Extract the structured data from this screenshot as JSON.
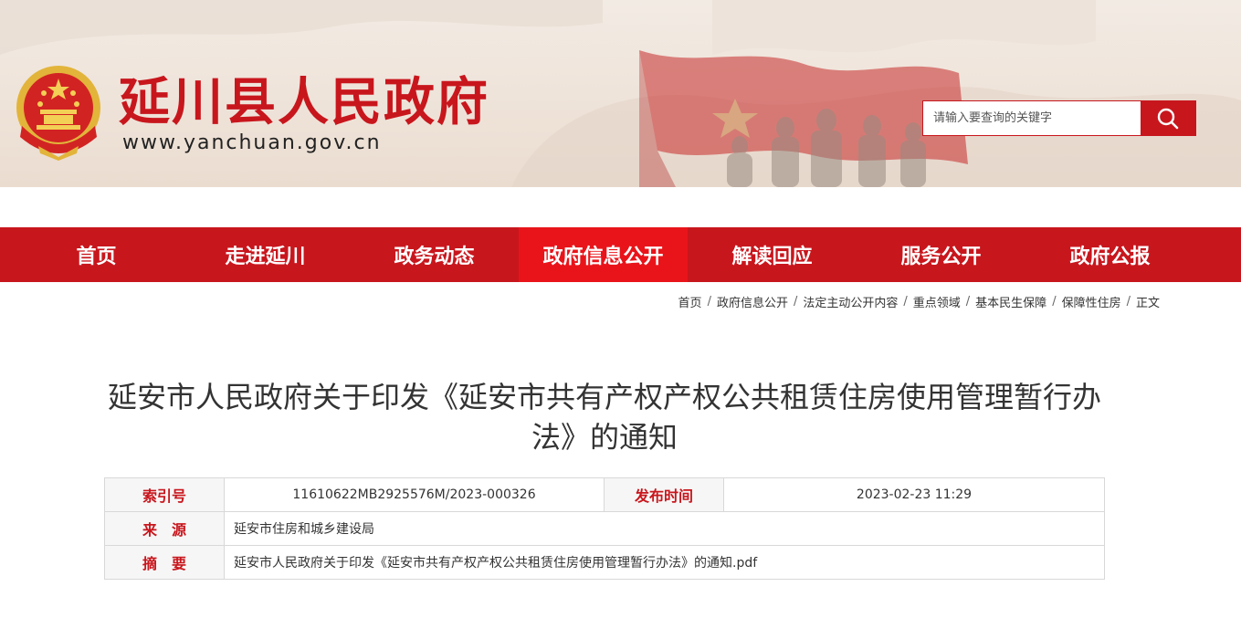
{
  "header": {
    "site_title": "延川县人民政府",
    "site_url": "www.yanchuan.gov.cn",
    "search_placeholder": "请输入要查询的关键字",
    "search_icon": "search-icon",
    "emblem_icon": "national-emblem-icon"
  },
  "nav": {
    "items": [
      {
        "label": "首页"
      },
      {
        "label": "走进延川"
      },
      {
        "label": "政务动态"
      },
      {
        "label": "政府信息公开",
        "active": true
      },
      {
        "label": "解读回应"
      },
      {
        "label": "服务公开"
      },
      {
        "label": "政府公报"
      }
    ]
  },
  "breadcrumb": {
    "items": [
      "首页",
      "政府信息公开",
      "法定主动公开内容",
      "重点领域",
      "基本民生保障",
      "保障性住房",
      "正文"
    ],
    "separator": "/"
  },
  "article": {
    "title_line1": "延安市人民政府关于印发《延安市共有产权产权公共租赁住房使用管理暂行办",
    "title_line2": "法》的通知"
  },
  "info": {
    "index_label": "索引号",
    "index_value": "11610622MB2925576M/2023-000326",
    "date_label": "发布时间",
    "date_value": "2023-02-23 11:29",
    "source_label": "来　源",
    "source_value": "延安市住房和城乡建设局",
    "summary_label": "摘　要",
    "summary_value": "延安市人民政府关于印发《延安市共有产权产权公共租赁住房使用管理暂行办法》的通知.pdf"
  },
  "colors": {
    "brand_red": "#c8161d",
    "nav_active": "#e8141a",
    "label_bg": "#f6f6f6"
  }
}
